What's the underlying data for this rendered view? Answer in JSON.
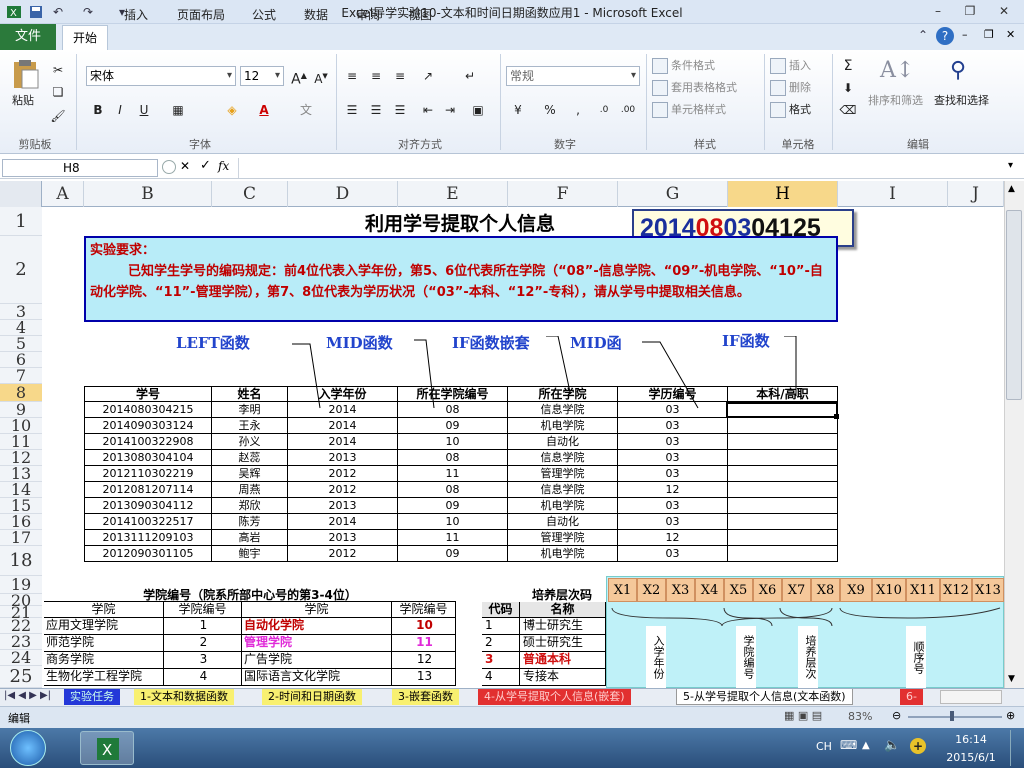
{
  "window": {
    "title": "Excel导学实验10-文本和时间日期函数应用1  -  Microsoft Excel",
    "minimize": "–",
    "restore": "❐",
    "close": "✕"
  },
  "ribbon_tabs": {
    "file": "文件",
    "home": "开始",
    "insert": "插入",
    "layout": "页面布局",
    "formulas": "公式",
    "data": "数据",
    "review": "审阅",
    "view": "视图"
  },
  "ribbon": {
    "clipboard": {
      "paste": "粘贴",
      "label": "剪贴板"
    },
    "font": {
      "name": "宋体",
      "size": "12",
      "label": "字体"
    },
    "align": {
      "label": "对齐方式"
    },
    "number": {
      "format": "常规",
      "percent": "%",
      "label": "数字"
    },
    "styles": {
      "cond": "条件格式",
      "table": "套用表格格式",
      "cell": "单元格样式",
      "label": "样式"
    },
    "cells": {
      "insert": "插入",
      "delete": "删除",
      "format": "格式",
      "label": "单元格"
    },
    "edit": {
      "sort": "排序和筛选",
      "find": "查找和选择",
      "label": "编辑"
    }
  },
  "formula_bar": {
    "name_box": "H8",
    "cancel": "✕",
    "enter": "✓",
    "fx": "fx",
    "value": ""
  },
  "columns": [
    "A",
    "B",
    "C",
    "D",
    "E",
    "F",
    "G",
    "H",
    "I",
    "J"
  ],
  "rows": [
    "1",
    "2",
    "3",
    "4",
    "5",
    "6",
    "7",
    "8",
    "9",
    "10",
    "11",
    "12",
    "13",
    "14",
    "15",
    "16",
    "17",
    "18",
    "19",
    "20",
    "21",
    "22",
    "23",
    "24",
    "25"
  ],
  "sheet": {
    "title": "利用学号提取个人信息",
    "id_parts": [
      "2014",
      "08",
      "03",
      "04125"
    ],
    "req_title": "实验要求：",
    "req_body": "已知学生学号的编码规定：前4位代表入学年份，第5、6位代表所在学院（“08”-信息学院、“09”-机电学院、“10”-自动化学院、“11”-管理学院），第7、8位代表为学历状况（“03”-本科、“12”-专科），请从学号中提取相关信息。",
    "labels": [
      "LEFT函数",
      "MID函数",
      "IF函数嵌套",
      "MID函",
      "IF函数"
    ],
    "headers": [
      "学号",
      "姓名",
      "入学年份",
      "所在学院编号",
      "所在学院",
      "学历编号",
      "本科/高职"
    ],
    "rows": [
      [
        "2014080304215",
        "李明",
        "2014",
        "08",
        "信息学院",
        "03",
        ""
      ],
      [
        "2014090303124",
        "王永",
        "2014",
        "09",
        "机电学院",
        "03",
        ""
      ],
      [
        "2014100322908",
        "孙义",
        "2014",
        "10",
        "自动化",
        "03",
        ""
      ],
      [
        "2013080304104",
        "赵蕊",
        "2013",
        "08",
        "信息学院",
        "03",
        ""
      ],
      [
        "2012110302219",
        "吴辉",
        "2012",
        "11",
        "管理学院",
        "03",
        ""
      ],
      [
        "2012081207114",
        "周燕",
        "2012",
        "08",
        "信息学院",
        "12",
        ""
      ],
      [
        "2013090304112",
        "郑欣",
        "2013",
        "09",
        "机电学院",
        "03",
        ""
      ],
      [
        "2014100322517",
        "陈芳",
        "2014",
        "10",
        "自动化",
        "03",
        ""
      ],
      [
        "2013111209103",
        "高岩",
        "2013",
        "11",
        "管理学院",
        "12",
        ""
      ],
      [
        "2012090301105",
        "鲍宇",
        "2012",
        "09",
        "机电学院",
        "03",
        ""
      ]
    ],
    "college_title": "学院编号（院系所部中心号的第3-4位）",
    "college_headers": [
      "学院",
      "学院编号",
      "学院",
      "学院编号"
    ],
    "college_rows": [
      [
        "应用文理学院",
        "1",
        "自动化学院",
        "10"
      ],
      [
        "师范学院",
        "2",
        "管理学院",
        "11"
      ],
      [
        "商务学院",
        "3",
        "广告学院",
        "12"
      ],
      [
        "生物化学工程学院",
        "4",
        "国际语言文化学院",
        "13"
      ]
    ],
    "level_title": "培养层次码",
    "level_headers": [
      "代码",
      "名称"
    ],
    "level_rows": [
      [
        "1",
        "博士研究生"
      ],
      [
        "2",
        "硕士研究生"
      ],
      [
        "3",
        "普通本科"
      ],
      [
        "4",
        "专接本"
      ]
    ],
    "x_labels": [
      "X1",
      "X2",
      "X3",
      "X4",
      "X5",
      "X6",
      "X7",
      "X8",
      "X9",
      "X10",
      "X11",
      "X12",
      "X13"
    ],
    "x_groups": [
      "入学年份",
      "学院编号",
      "培养层次",
      "顺序号"
    ]
  },
  "sheet_tabs": [
    "实验任务",
    "1-文本和数据函数",
    "2-时间和日期函数",
    "3-嵌套函数",
    "4-从学号提取个人信息(嵌套)",
    "5-从学号提取个人信息(文本函数)",
    "6-"
  ],
  "status": {
    "mode": "编辑",
    "zoom": "83%"
  },
  "taskbar": {
    "lang": "CH",
    "time": "16:14",
    "date": "2015/6/1"
  },
  "colors": {
    "accent_file": "#2b7a3b",
    "req_border": "#0000aa",
    "req_bg": "#b8ecf8",
    "id_border": "#2a3f8a",
    "selected_header": "#f7d88a"
  }
}
